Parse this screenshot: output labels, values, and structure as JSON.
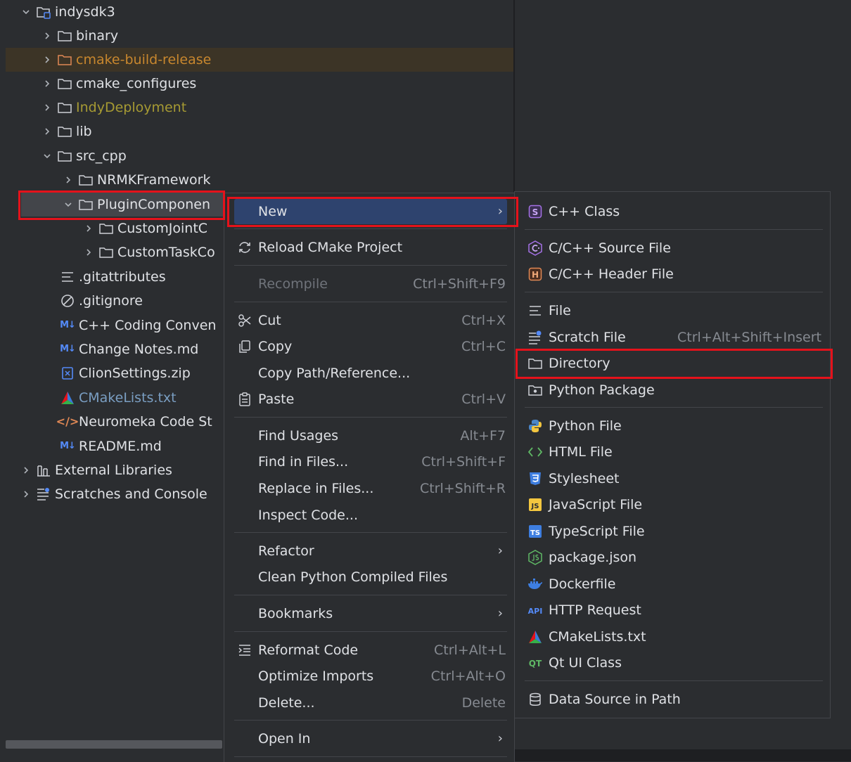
{
  "tree": {
    "root": {
      "label": "indysdk3",
      "icon": "module-folder-icon"
    },
    "items": [
      {
        "label": "binary"
      },
      {
        "label": "cmake-build-release"
      },
      {
        "label": "cmake_configures"
      },
      {
        "label": "IndyDeployment"
      },
      {
        "label": "lib"
      },
      {
        "label": "src_cpp"
      },
      {
        "label": "NRMKFramework"
      },
      {
        "label": "PluginComponen"
      },
      {
        "label": "CustomJointC"
      },
      {
        "label": "CustomTaskCo"
      },
      {
        "label": ".gitattributes"
      },
      {
        "label": ".gitignore"
      },
      {
        "label": "C++ Coding Conven",
        "badge": "M↓"
      },
      {
        "label": "Change Notes.md",
        "badge": "M↓"
      },
      {
        "label": "ClionSettings.zip"
      },
      {
        "label": "CMakeLists.txt"
      },
      {
        "label": "Neuromeka Code St",
        "badge": "</>"
      },
      {
        "label": "README.md",
        "badge": "M↓"
      },
      {
        "label": "External Libraries"
      },
      {
        "label": "Scratches and Console"
      }
    ]
  },
  "context_menu": {
    "items": [
      {
        "label": "New"
      },
      {
        "label": "Reload CMake Project"
      },
      {
        "label": "Recompile",
        "shortcut": "Ctrl+Shift+F9"
      },
      {
        "label": "Cut",
        "shortcut": "Ctrl+X"
      },
      {
        "label": "Copy",
        "shortcut": "Ctrl+C"
      },
      {
        "label": "Copy Path/Reference..."
      },
      {
        "label": "Paste",
        "shortcut": "Ctrl+V"
      },
      {
        "label": "Find Usages",
        "shortcut": "Alt+F7"
      },
      {
        "label": "Find in Files...",
        "shortcut": "Ctrl+Shift+F"
      },
      {
        "label": "Replace in Files...",
        "shortcut": "Ctrl+Shift+R"
      },
      {
        "label": "Inspect Code..."
      },
      {
        "label": "Refactor"
      },
      {
        "label": "Clean Python Compiled Files"
      },
      {
        "label": "Bookmarks"
      },
      {
        "label": "Reformat Code",
        "shortcut": "Ctrl+Alt+L"
      },
      {
        "label": "Optimize Imports",
        "shortcut": "Ctrl+Alt+O"
      },
      {
        "label": "Delete...",
        "shortcut": "Delete"
      },
      {
        "label": "Open In"
      }
    ],
    "submenu_arrow": "›"
  },
  "new_submenu": {
    "items": [
      {
        "label": "C++ Class",
        "badge": "S"
      },
      {
        "label": "C/C++ Source File"
      },
      {
        "label": "C/C++ Header File",
        "badge": "H"
      },
      {
        "label": "File"
      },
      {
        "label": "Scratch File",
        "shortcut": "Ctrl+Alt+Shift+Insert"
      },
      {
        "label": "Directory"
      },
      {
        "label": "Python Package"
      },
      {
        "label": "Python File"
      },
      {
        "label": "HTML File",
        "badge": "<>"
      },
      {
        "label": "Stylesheet"
      },
      {
        "label": "JavaScript File",
        "badge": "JS"
      },
      {
        "label": "TypeScript File",
        "badge": "TS"
      },
      {
        "label": "package.json"
      },
      {
        "label": "Dockerfile"
      },
      {
        "label": "HTTP Request",
        "badge": "API"
      },
      {
        "label": "CMakeLists.txt"
      },
      {
        "label": "Qt UI Class",
        "badge": "QT"
      },
      {
        "label": "Data Source in Path"
      }
    ]
  },
  "colors": {
    "background": "#2b2d30",
    "highlight": "#2e436e",
    "annotation_red": "#e5121b",
    "excluded_text": "#c8872e",
    "deployment_text": "#a69a33",
    "text": "#dfe1e5",
    "muted": "#868a91"
  }
}
